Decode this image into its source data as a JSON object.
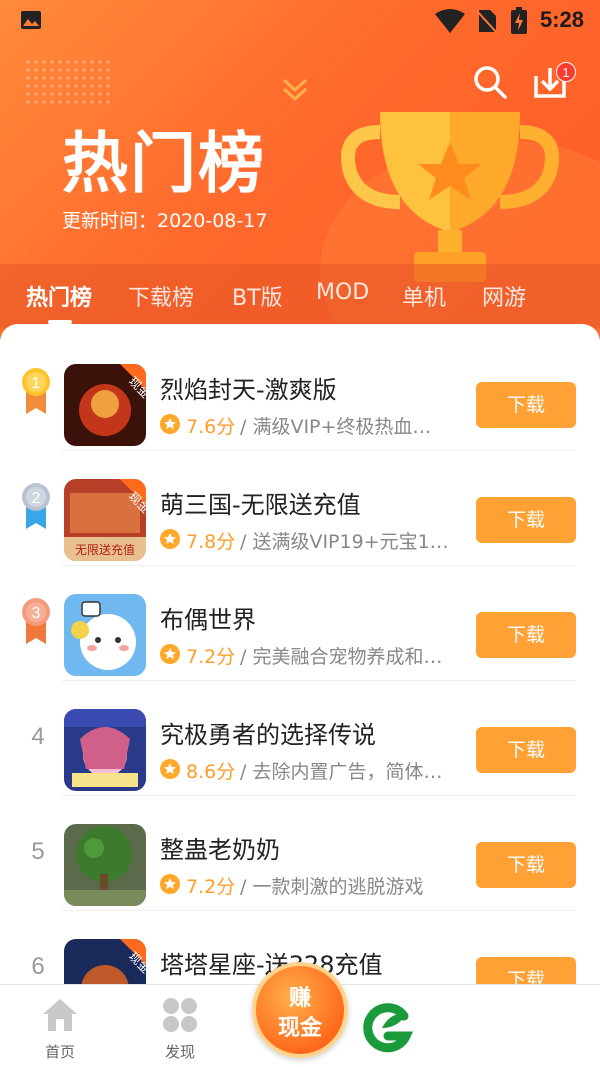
{
  "status_bar": {
    "time": "5:28"
  },
  "header": {
    "title": "热门榜",
    "update_label": "更新时间：2020-08-17",
    "download_badge": "1"
  },
  "tabs": [
    {
      "label": "热门榜",
      "active": true
    },
    {
      "label": "下载榜",
      "active": false
    },
    {
      "label": "BT版",
      "active": false
    },
    {
      "label": "MOD",
      "active": false
    },
    {
      "label": "单机",
      "active": false
    },
    {
      "label": "网游",
      "active": false
    }
  ],
  "apps": [
    {
      "rank": "1",
      "name": "烈焰封天-激爽版",
      "score": "7.6分",
      "desc": "/ 满级VIP+终极热血神…",
      "button": "下载"
    },
    {
      "rank": "2",
      "name": "萌三国-无限送充值",
      "score": "7.8分",
      "desc": "/ 送满级VIP19+元宝1…",
      "button": "下载"
    },
    {
      "rank": "3",
      "name": "布偶世界",
      "score": "7.2分",
      "desc": "/ 完美融合宠物养成和…",
      "button": "下载"
    },
    {
      "rank": "4",
      "name": "究极勇者的选择传说",
      "score": "8.6分",
      "desc": "/ 去除内置广告，简体…",
      "button": "下载"
    },
    {
      "rank": "5",
      "name": "整蛊老奶奶",
      "score": "7.2分",
      "desc": "/ 一款刺激的逃脱游戏",
      "button": "下载"
    },
    {
      "rank": "6",
      "name": "塔塔星座-送328充值",
      "score": "",
      "desc": "",
      "button": "下载"
    }
  ],
  "bottom_nav": {
    "home": "首页",
    "discover": "发现",
    "earn_line1": "赚",
    "earn_line2": "现金"
  },
  "colors": {
    "header_orange": "#ff6a2c",
    "button_orange": "#ffa135",
    "score_orange": "#ff9d2a"
  }
}
